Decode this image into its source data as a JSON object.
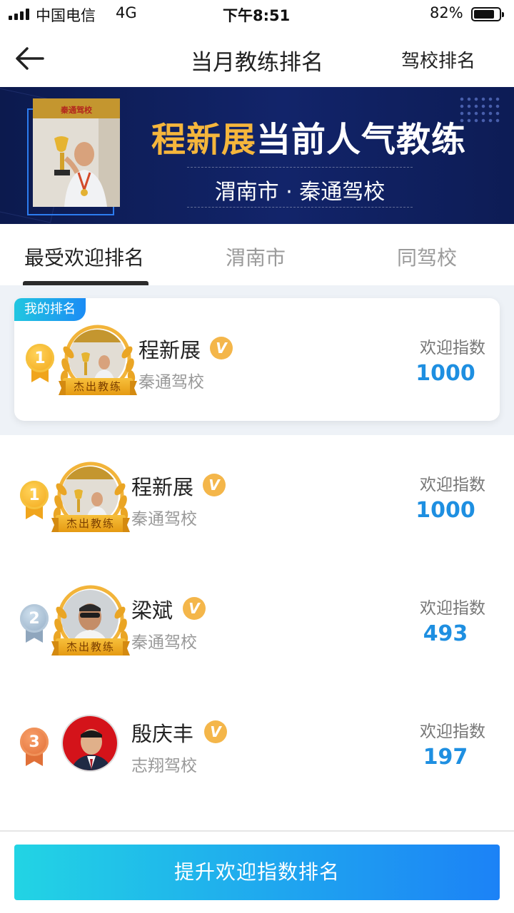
{
  "status_bar": {
    "carrier": "中国电信",
    "network": "4G",
    "time": "下午8:51",
    "battery_text": "82%",
    "battery_level": 0.82
  },
  "header": {
    "title": "当月教练排名",
    "right_link": "驾校排名"
  },
  "banner": {
    "name_highlight": "程新展",
    "headline_rest": "当前人气教练",
    "subtitle": "渭南市 · 秦通驾校",
    "photo_text": "秦通驾校"
  },
  "tabs": [
    {
      "label": "最受欢迎排名",
      "active": true
    },
    {
      "label": "渭南市",
      "active": false
    },
    {
      "label": "同驾校",
      "active": false
    }
  ],
  "my_rank": {
    "badge": "我的排名",
    "rank": "1",
    "medal": "gold",
    "name": "程新展",
    "verified_icon": "V",
    "school": "秦通驾校",
    "score_label": "欢迎指数",
    "score": "1000",
    "award": "杰出教练"
  },
  "rankings": [
    {
      "rank": "1",
      "medal": "gold",
      "name": "程新展",
      "verified_icon": "V",
      "school": "秦通驾校",
      "score_label": "欢迎指数",
      "score": "1000",
      "award": "杰出教练"
    },
    {
      "rank": "2",
      "medal": "silver",
      "name": "梁斌",
      "verified_icon": "V",
      "school": "秦通驾校",
      "score_label": "欢迎指数",
      "score": "493",
      "award": "杰出教练"
    },
    {
      "rank": "3",
      "medal": "bronze",
      "name": "殷庆丰",
      "verified_icon": "V",
      "school": "志翔驾校",
      "score_label": "欢迎指数",
      "score": "197",
      "award": ""
    }
  ],
  "bottom_button": "提升欢迎指数排名",
  "colors": {
    "accent_blue": "#1e8fe1",
    "gold": "#f5b63c",
    "banner_bg": "#0c1a4e"
  }
}
